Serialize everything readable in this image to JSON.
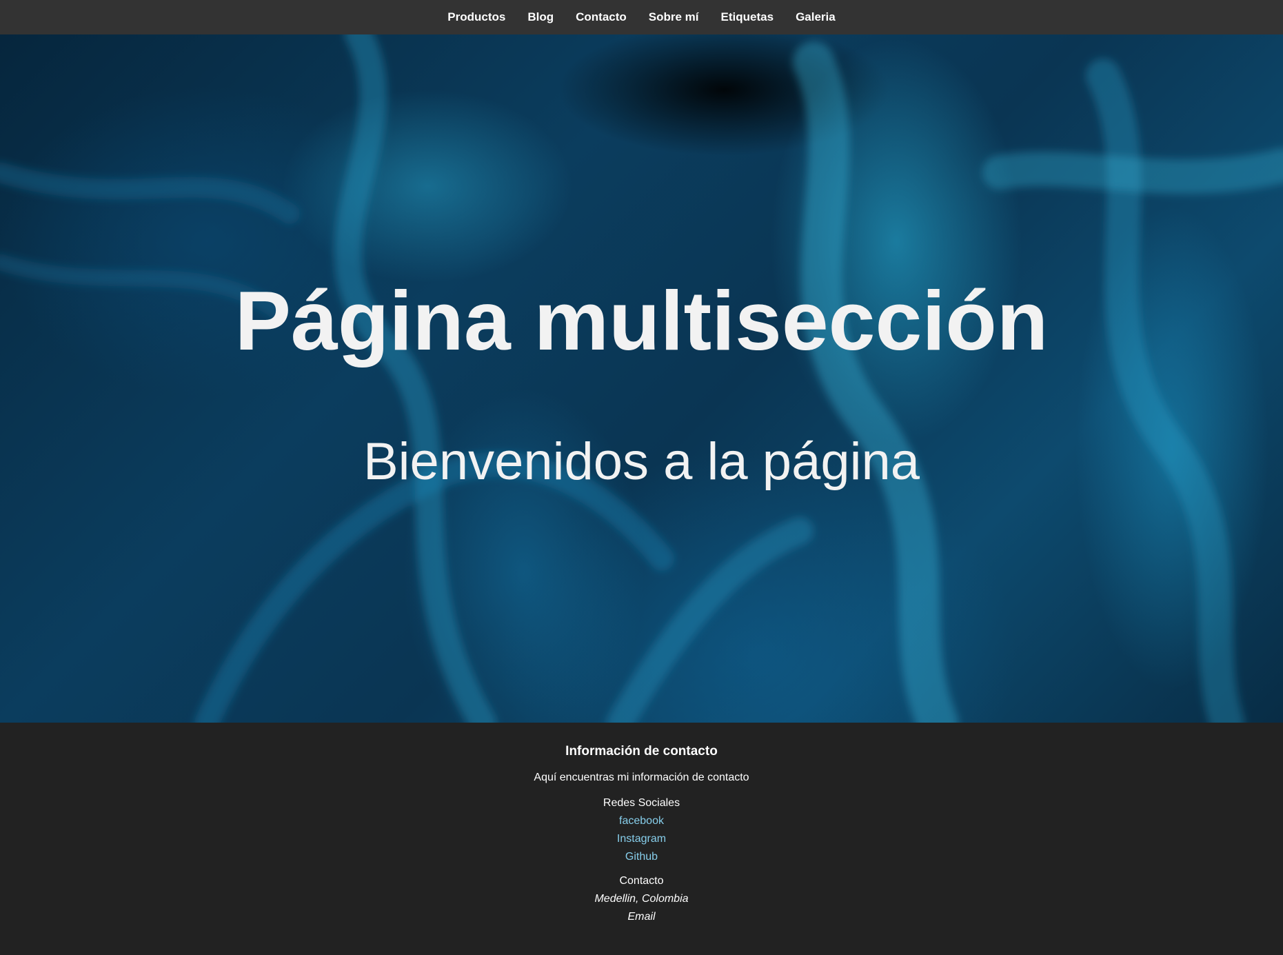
{
  "nav": {
    "items": [
      {
        "label": "Productos"
      },
      {
        "label": "Blog"
      },
      {
        "label": "Contacto"
      },
      {
        "label": "Sobre mí"
      },
      {
        "label": "Etiquetas"
      },
      {
        "label": "Galeria"
      }
    ],
    "background": "#333333"
  },
  "hero": {
    "title": "Página multisección",
    "subtitle": "Bienvenidos a la página"
  },
  "footer": {
    "heading": "Información de contacto",
    "intro": "Aquí encuentras mi información de contacto",
    "social_heading": "Redes Sociales",
    "social_links": [
      {
        "label": "facebook"
      },
      {
        "label": "Instagram"
      },
      {
        "label": "Github"
      }
    ],
    "contact_heading": "Contacto",
    "location": "Medellin, Colombia",
    "email": "Email",
    "link_color": "#87ceeb",
    "background": "#222222"
  }
}
